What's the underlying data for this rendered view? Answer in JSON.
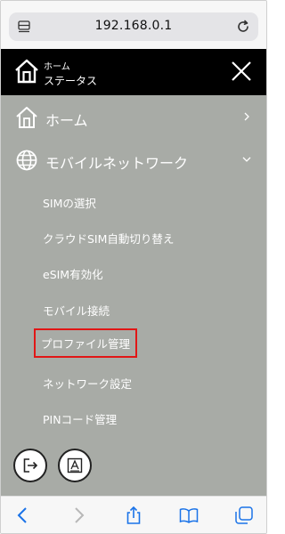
{
  "browser": {
    "url": "192.168.0.1",
    "reload_icon": "reload-icon",
    "tab_icon": "tab-overview-icon"
  },
  "header": {
    "breadcrumb": "ホーム",
    "title": "ステータス",
    "logo_icon": "home-icon",
    "close_icon": "close-icon"
  },
  "menu": {
    "items": [
      {
        "label": "ホーム",
        "icon": "home-icon",
        "chevron": "chevron-right-icon"
      },
      {
        "label": "モバイルネットワーク",
        "icon": "globe-icon",
        "chevron": "chevron-down-icon",
        "subitems": [
          {
            "label": "SIMの選択"
          },
          {
            "label": "クラウドSIM自動切り替え"
          },
          {
            "label": "eSIM有効化"
          },
          {
            "label": "モバイル接続"
          },
          {
            "label": "プロファイル管理",
            "highlighted": true
          },
          {
            "label": "ネットワーク設定"
          },
          {
            "label": "PINコード管理"
          }
        ]
      }
    ],
    "bottom_buttons": [
      {
        "icon": "logout-icon"
      },
      {
        "icon": "font-size-icon"
      }
    ]
  },
  "toolbar": {
    "buttons": [
      "back-icon",
      "forward-icon",
      "share-icon",
      "bookmarks-icon",
      "tabs-icon"
    ]
  },
  "colors": {
    "header_bg": "#000000",
    "menu_bg": "#a8aba6",
    "highlight": "#e11616",
    "toolbar_tint": "#1a73e8"
  }
}
